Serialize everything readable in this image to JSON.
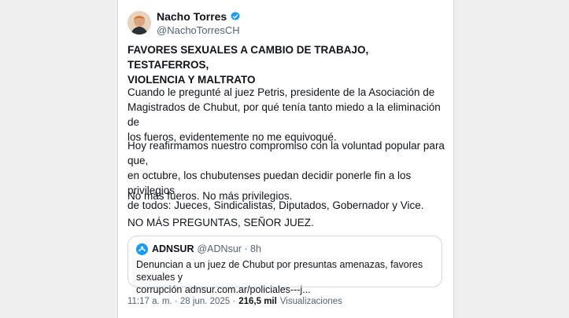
{
  "author": {
    "name": "Nacho Torres",
    "handle": "@NachoTorresCH"
  },
  "tweet": {
    "headline_line1": "FAVORES SEXUALES A CAMBIO DE TRABAJO, TESTAFERROS,",
    "headline_line2": "VIOLENCIA Y MALTRATO",
    "p1_l1": "Cuando le pregunté al juez Petris, presidente de la Asociación de",
    "p1_l2": "Magistrados de Chubut, por qué tenía tanto miedo a la eliminación de",
    "p1_l3": "los fueros, evidentemente no me equivoqué.",
    "p2_l1": "Hoy reafirmamos nuestro compromiso con la voluntad popular para que,",
    "p2_l2": "en octubre, los chubutenses puedan decidir ponerle fin a los privilegios",
    "p2_l3": "de todos: Jueces, Sindicalistas, Diputados, Gobernador y Vice.",
    "p3": "No más fueros. No más privilegios.",
    "p4": "NO MÁS PREGUNTAS, SEÑOR JUEZ."
  },
  "quote": {
    "name": "ADNSUR",
    "handle_time": "@ADNsur · 8h",
    "text_l1": "Denuncian a un juez de Chubut por presuntas amenazas, favores sexuales y",
    "text_l2": "corrupción adnsur.com.ar/policiales---j..."
  },
  "footer": {
    "timestamp": "11:17 a. m. · 28 jun. 2025 ·",
    "views_count": "216,5 mil",
    "views_label": "Visualizaciones"
  },
  "colors": {
    "verified": "#1d9bf0",
    "secondary_text": "#536471"
  }
}
